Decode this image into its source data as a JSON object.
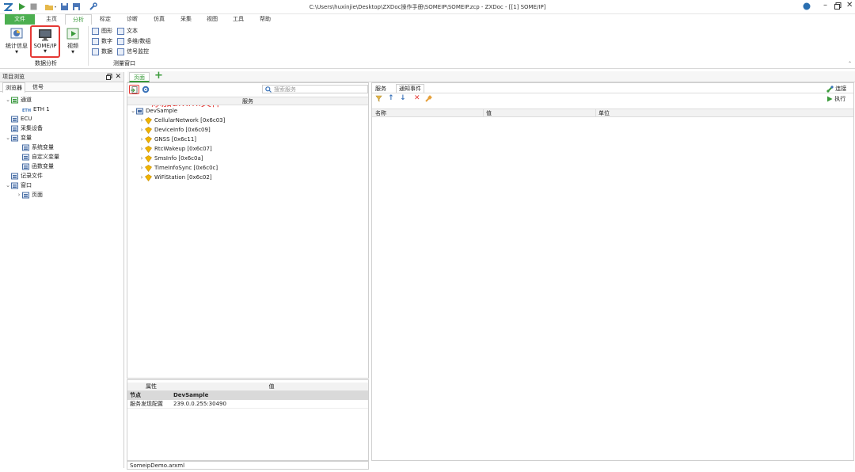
{
  "window": {
    "title": "C:\\Users\\huxinjie\\Desktop\\ZXDoc操作手册\\SOMEIP\\SOMEIP.zcp - ZXDoc - [[1] SOME/IP]"
  },
  "ribbon": {
    "tabs": [
      "文件",
      "主页",
      "分析",
      "标定",
      "诊断",
      "仿真",
      "采集",
      "视图",
      "工具",
      "帮助"
    ],
    "active_tab": "分析",
    "stats_label": "统计信息",
    "someip_label": "SOME/IP",
    "video_label": "视频",
    "group_analysis": "数据分析",
    "group_measure": "测量窗口",
    "measure_items": [
      "图形",
      "文本",
      "数字",
      "多维/数组",
      "数据",
      "信号监控"
    ]
  },
  "project": {
    "title": "项目浏览",
    "tabs": [
      "浏览器",
      "信号"
    ],
    "tree": [
      {
        "label": "通道",
        "level": 0,
        "expand": "v",
        "icon": "channel-icon"
      },
      {
        "label": "ETH 1",
        "level": 1,
        "expand": "",
        "icon": "eth-icon",
        "prefix": "ETH"
      },
      {
        "label": "ECU",
        "level": 0,
        "expand": "",
        "icon": "ecu-icon"
      },
      {
        "label": "采集设备",
        "level": 0,
        "expand": "",
        "icon": "device-icon"
      },
      {
        "label": "变量",
        "level": 0,
        "expand": "v",
        "icon": "variable-icon"
      },
      {
        "label": "系统变量",
        "level": 1,
        "expand": "",
        "icon": "sysvar-icon"
      },
      {
        "label": "自定义变量",
        "level": 1,
        "expand": "",
        "icon": "custvar-icon"
      },
      {
        "label": "函数变量",
        "level": 1,
        "expand": "",
        "icon": "funcvar-icon"
      },
      {
        "label": "记录文件",
        "level": 0,
        "expand": "",
        "icon": "logfile-icon"
      },
      {
        "label": "窗口",
        "level": 0,
        "expand": "v",
        "icon": "window-icon"
      },
      {
        "label": "页面",
        "level": 1,
        "expand": ">",
        "icon": "page-icon"
      }
    ]
  },
  "doc_tabs": {
    "page_label": "页面",
    "add_label": "+"
  },
  "service_panel": {
    "search_placeholder": "搜索服务",
    "annotation": "添加arxml文件",
    "column": "服务",
    "root": "DevSample",
    "services": [
      "CellularNetwork [0x6c03]",
      "DeviceInfo [0x6c09]",
      "GNSS [0x6c11]",
      "RtcWakeup [0x6c07]",
      "SmsInfo [0x6c0a]",
      "TimeInfoSync [0x6c0c]",
      "WiFiStation [0x6c02]"
    ]
  },
  "properties": {
    "col_attr": "属性",
    "col_value": "值",
    "rows": [
      {
        "name": "节点",
        "value": "DevSample"
      },
      {
        "name": "服务发现配置",
        "value": "239.0.0.255:30490"
      }
    ],
    "status_file": "SomeipDemo.arxml"
  },
  "right_panel": {
    "tabs": [
      "服务",
      "通知事件"
    ],
    "connect_label": "连接",
    "execute_label": "执行",
    "columns": [
      "名称",
      "值",
      "单位"
    ]
  },
  "colors": {
    "accent_green": "#3a9a3a",
    "file_tab": "#4caf50",
    "annotation": "#e53935",
    "tree_blue": "#4a6fa5"
  }
}
